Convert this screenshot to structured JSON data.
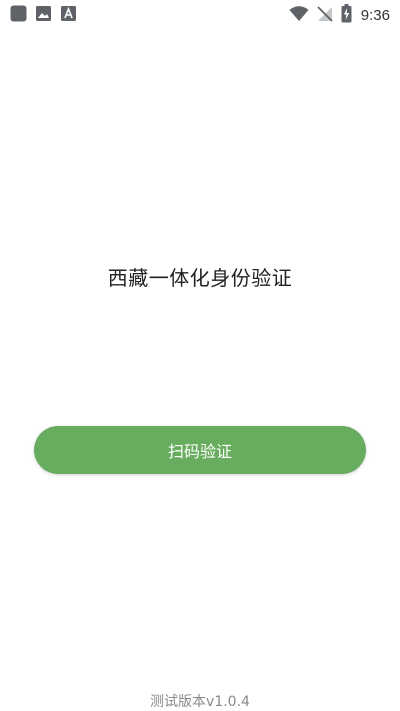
{
  "status_bar": {
    "time": "9:36",
    "left_icons": [
      "app-square-icon",
      "image-icon",
      "font-a-icon"
    ],
    "right_icons": [
      "wifi-icon",
      "no-signal-icon",
      "battery-charging-icon"
    ]
  },
  "main": {
    "title": "西藏一体化身份验证",
    "scan_button_label": "扫码验证"
  },
  "footer": {
    "version": "测试版本v1.0.4"
  },
  "colors": {
    "accent": "#68ad5f",
    "background": "#ffffff",
    "title_text": "#222222",
    "version_text": "#8a8a8a"
  }
}
